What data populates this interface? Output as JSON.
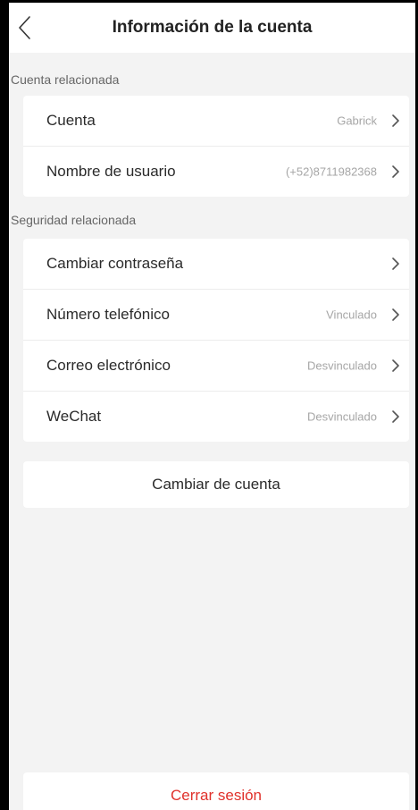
{
  "header": {
    "title": "Información de la cuenta",
    "back_icon": "chevron-left-icon"
  },
  "account_section": {
    "label": "Cuenta relacionada",
    "items": [
      {
        "label": "Cuenta",
        "value": "Gabrick"
      },
      {
        "label": "Nombre de usuario",
        "value": "(+52)8711982368"
      }
    ]
  },
  "security_section": {
    "label": "Seguridad relacionada",
    "items": [
      {
        "label": "Cambiar contraseña",
        "value": ""
      },
      {
        "label": "Número telefónico",
        "value": "Vinculado"
      },
      {
        "label": "Correo electrónico",
        "value": "Desvinculado"
      },
      {
        "label": "WeChat",
        "value": "Desvinculado"
      }
    ]
  },
  "switch_account": {
    "label": "Cambiar de cuenta"
  },
  "logout": {
    "label": "Cerrar sesión"
  },
  "colors": {
    "background": "#f3f3f3",
    "card": "#ffffff",
    "logout_text": "#e0312b",
    "secondary_text": "#a6a6a6"
  }
}
